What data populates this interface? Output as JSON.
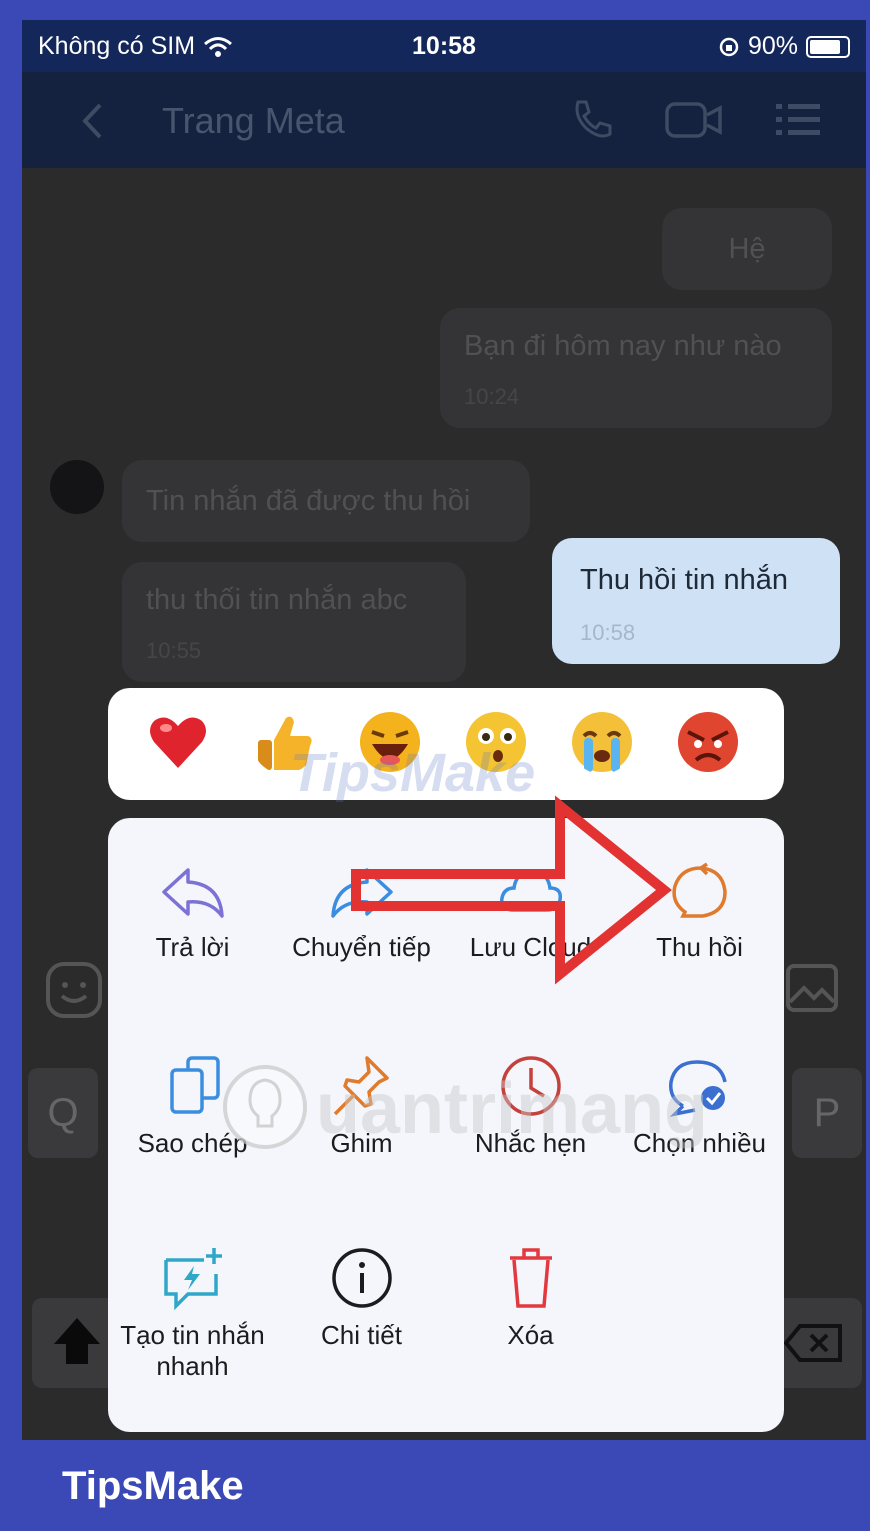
{
  "status_bar": {
    "carrier": "Không có SIM",
    "time": "10:58",
    "battery": "90%"
  },
  "nav": {
    "back_icon": "chevron-left-icon",
    "title": "Trang Meta",
    "phone_icon": "phone-icon",
    "video_icon": "video-icon",
    "menu_icon": "list-icon"
  },
  "messages": [
    {
      "text": "Hệ",
      "time": ""
    },
    {
      "text": "Bạn đi hôm nay như nào",
      "time": "10:24"
    },
    {
      "text": "Tin nhắn đã được thu hồi",
      "time": ""
    },
    {
      "text": "thu thối tin nhắn abc",
      "time": "10:55"
    },
    {
      "text": "Thu hồi tin nhắn",
      "time": "10:58"
    }
  ],
  "keyboard": {
    "q": "Q",
    "p": "P"
  },
  "reactions": [
    "heart",
    "thumbs-up",
    "laughing",
    "surprised",
    "crying",
    "angry"
  ],
  "menu": {
    "items": [
      {
        "label": "Trả lời",
        "icon": "reply-icon"
      },
      {
        "label": "Chuyển tiếp",
        "icon": "forward-icon"
      },
      {
        "label": "Lưu Cloud",
        "icon": "cloud-icon"
      },
      {
        "label": "Thu hồi",
        "icon": "recall-icon"
      },
      {
        "label": "Sao chép",
        "icon": "copy-icon"
      },
      {
        "label": "Ghim",
        "icon": "pin-icon"
      },
      {
        "label": "Nhắc hẹn",
        "icon": "clock-icon"
      },
      {
        "label": "Chọn nhiều",
        "icon": "multi-select-icon"
      },
      {
        "label": "Tạo tin nhắn nhanh",
        "icon": "quick-message-icon"
      },
      {
        "label": "Chi tiết",
        "icon": "info-icon"
      },
      {
        "label": "Xóa",
        "icon": "trash-icon"
      }
    ]
  },
  "watermarks": {
    "tipsmake": "TipsMake",
    "quantrimang": "uantrimang"
  },
  "footer": {
    "brand": "TipsMake"
  },
  "colors": {
    "frame": "#3b49b6",
    "accent_red": "#e23232",
    "recall_orange": "#e07a2d"
  }
}
